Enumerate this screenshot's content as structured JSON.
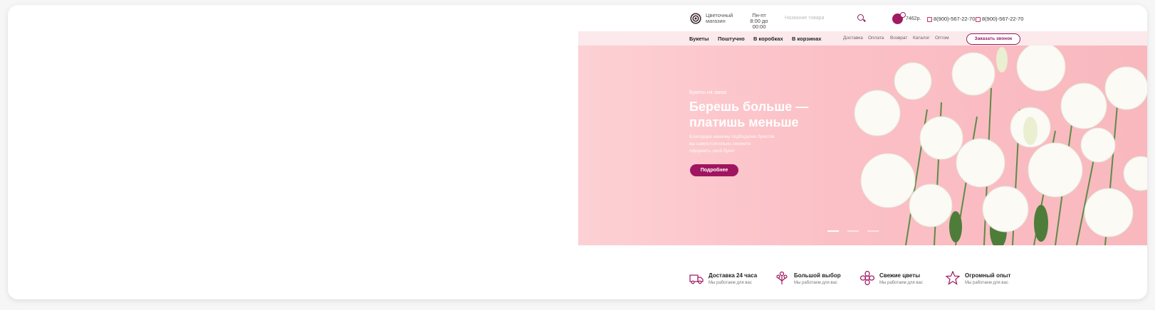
{
  "header": {
    "logo_text": "Цветочный магазин",
    "hours_days": "Пн-пт",
    "hours_time": "8:00 до 00:00",
    "search_placeholder": "Название товара",
    "cart_price": "7462р.",
    "phone1": "8(900)-567-22-70",
    "phone2": "8(900)-567-22-70"
  },
  "nav": {
    "main": [
      "Букеты",
      "Поштучно",
      "В коробках",
      "В корзинах"
    ],
    "secondary": [
      "Доставка",
      "Оплата",
      "Возврат",
      "Каталог",
      "Оптом"
    ],
    "callback_label": "Заказать звонок"
  },
  "hero": {
    "eyebrow": "Букеты на заказ",
    "title_line1": "Берешь больше —",
    "title_line2": "платишь меньше",
    "text_line1": "Благодаря нашему подбору/ию букетов",
    "text_line2": "вы самостоятельно сможете",
    "text_line3": "оформить свой букет",
    "button_label": "Подробнее",
    "slides_total": 3,
    "slide_active": 1
  },
  "features": [
    {
      "title": "Доставка 24 часа",
      "subtitle": "Мы работаем для вас",
      "icon": "truck-icon"
    },
    {
      "title": "Большой выбор",
      "subtitle": "Мы работаем для вас",
      "icon": "bouquet-icon"
    },
    {
      "title": "Свежие цветы",
      "subtitle": "Мы работаем для вас",
      "icon": "flower-icon"
    },
    {
      "title": "Огромный опыт",
      "subtitle": "Мы работаем для вас",
      "icon": "star-icon"
    }
  ],
  "colors": {
    "accent": "#a0155f",
    "hero_bg": "#fbc0c6",
    "nav_bg": "#fbe9ec"
  }
}
